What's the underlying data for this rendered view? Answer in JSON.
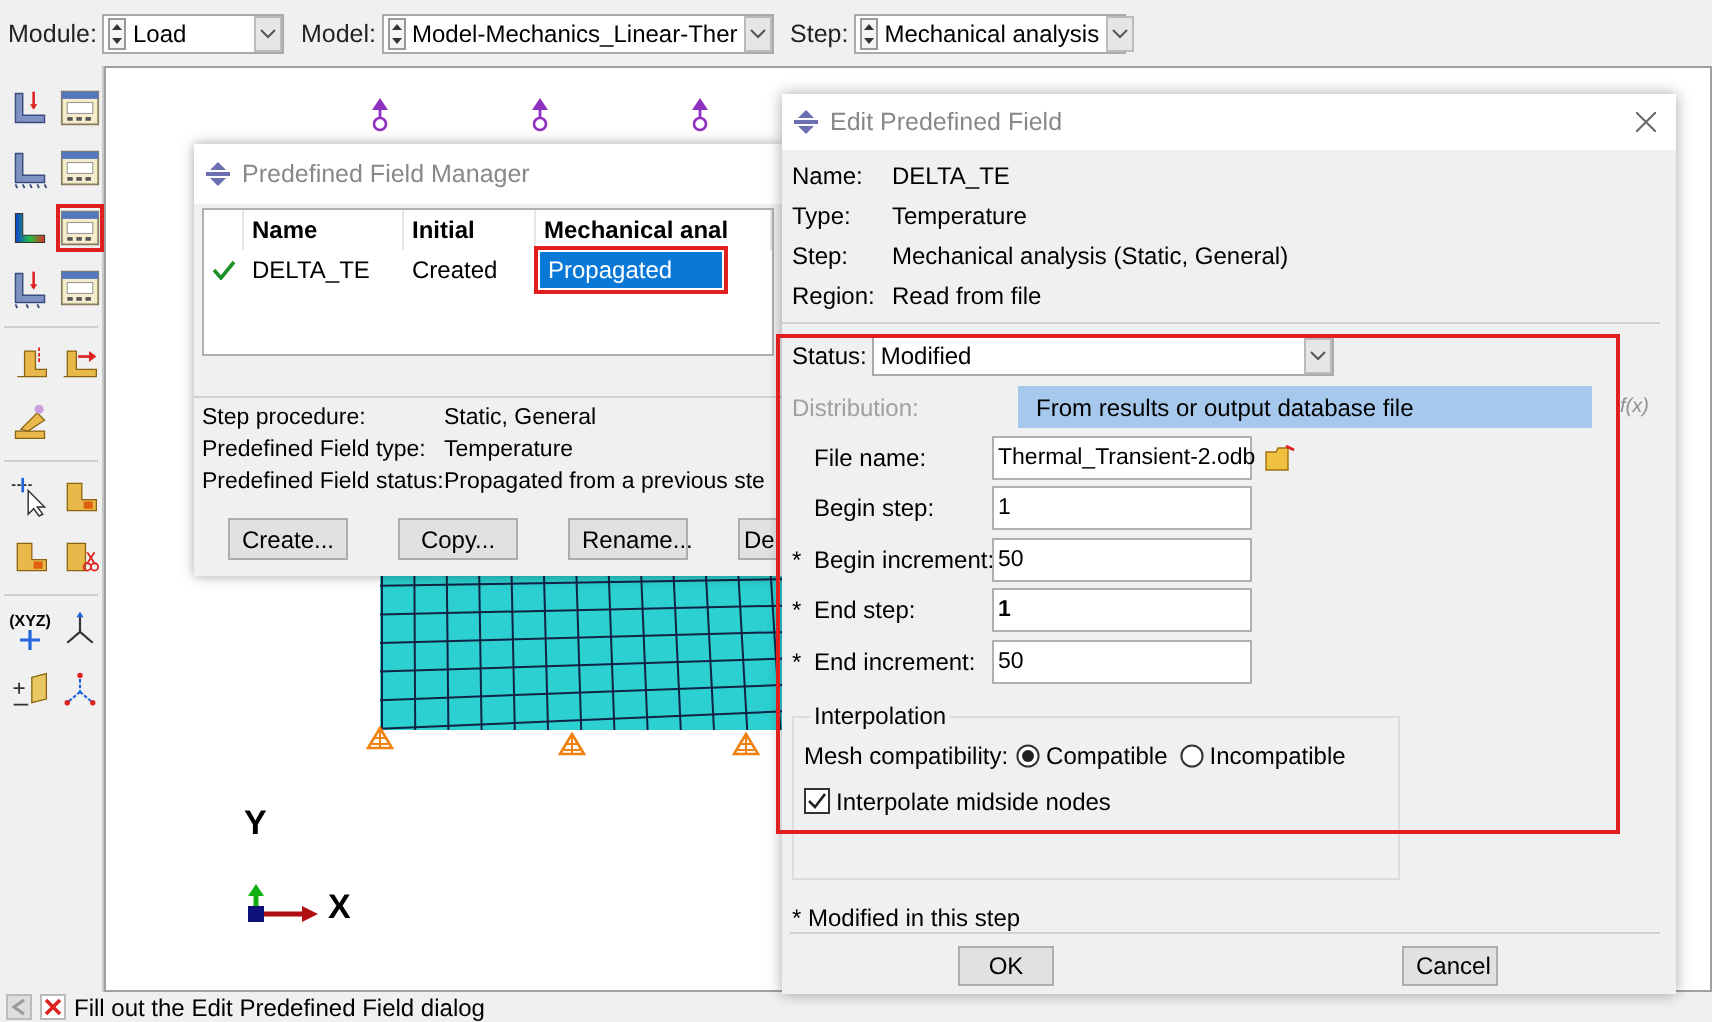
{
  "topbar": {
    "fields": [
      {
        "kind": "module",
        "label": "Module:",
        "value": "Load"
      },
      {
        "kind": "model",
        "label": "Model:",
        "value": "Model-Mechanics_Linear-Ther"
      },
      {
        "kind": "step",
        "label": "Step:",
        "value": "Mechanical analysis"
      }
    ]
  },
  "toolbox": {
    "groups": [
      [
        {
          "kind": "lshape-arrow",
          "highlighted": false
        },
        {
          "kind": "manager",
          "highlighted": false
        },
        {
          "kind": "lshape-base",
          "highlighted": false
        },
        {
          "kind": "manager",
          "highlighted": false
        },
        {
          "kind": "lshape-gradient",
          "highlighted": false
        },
        {
          "kind": "manager",
          "highlighted": true
        },
        {
          "kind": "lshape-base-arrow",
          "highlighted": false
        },
        {
          "kind": "manager",
          "highlighted": false
        }
      ],
      [
        {
          "kind": "block-arrow",
          "highlighted": false
        },
        {
          "kind": "block-push",
          "highlighted": false
        },
        {
          "kind": "block-slant",
          "highlighted": false
        }
      ],
      [
        {
          "kind": "point-cursor",
          "highlighted": false
        },
        {
          "kind": "block-orange",
          "highlighted": false
        },
        {
          "kind": "block-orange",
          "highlighted": false
        },
        {
          "kind": "block-scissors",
          "highlighted": false
        }
      ],
      [
        {
          "kind": "xyz",
          "label": "(XYZ)",
          "highlighted": false
        },
        {
          "kind": "triad",
          "highlighted": false
        },
        {
          "kind": "plane",
          "highlighted": false
        },
        {
          "kind": "triad-red",
          "highlighted": false
        }
      ]
    ]
  },
  "viewport": {
    "triad": {
      "y_label": "Y",
      "x_label": "X"
    }
  },
  "manager": {
    "title": "Predefined Field Manager",
    "columns": [
      "Name",
      "Initial",
      "Mechanical anal"
    ],
    "rows": [
      {
        "active": true,
        "cells": [
          {
            "text": "DELTA_TE",
            "selected": false,
            "highlighted": false
          },
          {
            "text": "Created",
            "selected": false,
            "highlighted": false
          },
          {
            "text": "Propagated",
            "selected": true,
            "highlighted": true
          }
        ]
      }
    ],
    "details": [
      {
        "label": "Step procedure:",
        "value": "Static, General"
      },
      {
        "label": "Predefined Field type:",
        "value": "Temperature"
      },
      {
        "label": "Predefined Field status:",
        "value": "Propagated from a previous ste"
      }
    ],
    "buttons": [
      "Create...",
      "Copy...",
      "Rename...",
      "De"
    ]
  },
  "editor": {
    "title": "Edit Predefined Field",
    "highlighted": true,
    "info": [
      {
        "label": "Name:",
        "value": "DELTA_TE"
      },
      {
        "label": "Type:",
        "value": "Temperature"
      },
      {
        "label": "Step:",
        "value": "Mechanical analysis (Static, General)"
      },
      {
        "label": "Region:",
        "value": "Read from file"
      }
    ],
    "status": {
      "label": "Status:",
      "value": "Modified"
    },
    "distribution": {
      "label": "Distribution:",
      "value": "From results or output database file",
      "disabled": true,
      "function_label": "f(x)"
    },
    "fields": [
      {
        "kind": "file",
        "label": "File name:",
        "value": "Thermal_Transient-2.odb",
        "bold": false
      },
      {
        "kind": "text",
        "label": "Begin step:",
        "value": "1",
        "bold": false
      },
      {
        "kind": "text",
        "mark": "*",
        "label": "Begin increment:",
        "value": "50",
        "bold": false
      },
      {
        "kind": "text",
        "mark": "*",
        "label": "End step:",
        "value": "1",
        "bold": true
      },
      {
        "kind": "text",
        "mark": "*",
        "label": "End increment:",
        "value": "50",
        "bold": false
      }
    ],
    "interpolation": {
      "title": "Interpolation",
      "label": "Mesh compatibility:",
      "options": [
        {
          "label": "Compatible",
          "selected": true
        },
        {
          "label": "Incompatible",
          "selected": false
        }
      ],
      "checkbox": {
        "label": "Interpolate midside nodes",
        "checked": true
      }
    },
    "note": "* Modified in this step",
    "buttons": [
      "OK",
      "Cancel"
    ]
  },
  "status_bar": {
    "message": "Fill out the Edit Predefined Field dialog"
  }
}
